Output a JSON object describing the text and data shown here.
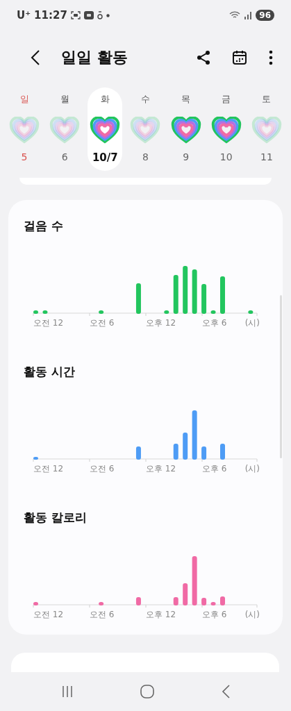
{
  "status_bar": {
    "carrier": "U⁺",
    "time": "11:27",
    "battery": "96"
  },
  "header": {
    "title": "일일 활동"
  },
  "week": [
    {
      "weekday": "일",
      "date": "5",
      "sunday": true,
      "selected": false,
      "goal_met": false
    },
    {
      "weekday": "월",
      "date": "6",
      "sunday": false,
      "selected": false,
      "goal_met": false
    },
    {
      "weekday": "화",
      "date": "10/7",
      "sunday": false,
      "selected": true,
      "goal_met": true
    },
    {
      "weekday": "수",
      "date": "8",
      "sunday": false,
      "selected": false,
      "goal_met": false
    },
    {
      "weekday": "목",
      "date": "9",
      "sunday": false,
      "selected": false,
      "goal_met": true
    },
    {
      "weekday": "금",
      "date": "10",
      "sunday": false,
      "selected": false,
      "goal_met": true
    },
    {
      "weekday": "토",
      "date": "11",
      "sunday": false,
      "selected": false,
      "goal_met": false
    }
  ],
  "charts": [
    {
      "title": "걸음 수",
      "kind": "steps",
      "color": "#22c55e",
      "x_labels": [
        "오전 12",
        "오전 6",
        "오후 12",
        "오후 6"
      ],
      "unit": "(시)"
    },
    {
      "title": "활동 시간",
      "kind": "time",
      "color": "#4e9cf5",
      "x_labels": [
        "오전 12",
        "오전 6",
        "오후 12",
        "오후 6"
      ],
      "unit": "(시)"
    },
    {
      "title": "활동 칼로리",
      "kind": "calories",
      "color": "#f06aa5",
      "x_labels": [
        "오전 12",
        "오전 6",
        "오후 12",
        "오후 6"
      ],
      "unit": "(시)"
    }
  ]
}
